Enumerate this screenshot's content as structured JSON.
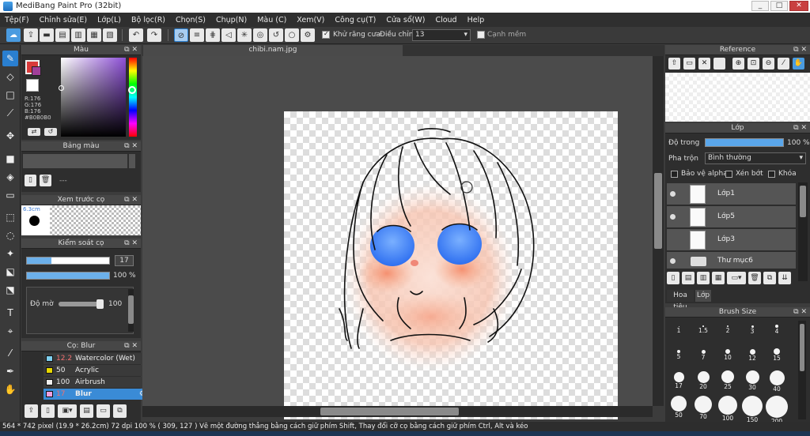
{
  "window": {
    "title": "MediBang Paint Pro (32bit)",
    "btn_min": "_",
    "btn_max": "□",
    "btn_close": "✕"
  },
  "menu": [
    "Tệp(F)",
    "Chỉnh sửa(E)",
    "Lớp(L)",
    "Bộ lọc(R)",
    "Chọn(S)",
    "Chụp(N)",
    "Màu (C)",
    "Xem(V)",
    "Công cụ(T)",
    "Cửa sổ(W)",
    "Cloud",
    "Help"
  ],
  "toolbar": {
    "antialias_label": "Khử răng cưa",
    "adjust_label": "Điều chỉnh",
    "adjust_value": "13",
    "edge_label": "Cạnh mềm",
    "antialias_checked": true,
    "edge_checked": false
  },
  "color_panel": {
    "title": "Màu",
    "r": "R:176",
    "g": "G:176",
    "b": "B:176",
    "hex": "#B0B0B0",
    "fg_color": "#d83a3a",
    "bg_color": "#b0b0b0"
  },
  "palette_panel": {
    "title": "Bảng màu",
    "value": "---"
  },
  "brush_preview": {
    "title": "Xem trước cọ",
    "size": "6.3cm"
  },
  "brush_control": {
    "title": "Kiểm soát cọ",
    "size_value": "17",
    "size_level": 0.3,
    "opacity_value": "100 %",
    "opacity_level": 1.0,
    "blur_label": "Độ mờ",
    "blur_value": "100",
    "blur_level": 1.0
  },
  "brush_list": {
    "title": "Cọ: Blur",
    "items": [
      {
        "value": "12.2",
        "name": "Watercolor (Wet)",
        "color": "#7fd0f0"
      },
      {
        "value": "50",
        "name": "Acrylic",
        "color": "#e8d800"
      },
      {
        "value": "100",
        "name": "Airbrush",
        "color": "#f0f0f0"
      },
      {
        "value": "17",
        "name": "Blur",
        "color": "#f0a0e0"
      }
    ]
  },
  "canvas": {
    "tab": "chibi.nam.jpg"
  },
  "reference": {
    "title": "Reference"
  },
  "layers": {
    "title": "Lớp",
    "opacity_label": "Độ trong",
    "opacity_value": "100 %",
    "opacity_level": 1.0,
    "blend_label": "Pha trộn",
    "blend_value": "Bình thường",
    "protect_alpha": "Bảo vệ alpha",
    "clip": "Xén bớt",
    "lock": "Khóa",
    "items": [
      "Lớp1",
      "Lớp5",
      "Lớp3",
      "Thư mục6"
    ]
  },
  "tabs": {
    "tab1": "Hoa tiêu",
    "tab2": "Lớp"
  },
  "brush_size": {
    "title": "Brush Size",
    "rows": [
      [
        "1",
        "1.5",
        "2",
        "3",
        "4"
      ],
      [
        "5",
        "7",
        "10",
        "12",
        "15"
      ],
      [
        "17",
        "20",
        "25",
        "30",
        "40"
      ],
      [
        "50",
        "70",
        "100",
        "150",
        "200"
      ]
    ]
  },
  "status": {
    "text": "564 * 742 pixel   (19.9 * 26.2cm)   72 dpi   100 %   ( 309, 127 )   Vẽ một đường thẳng bằng cách giữ phím Shift, Thay đổi cỡ cọ bằng cách giữ phím Ctrl, Alt và kéo"
  }
}
